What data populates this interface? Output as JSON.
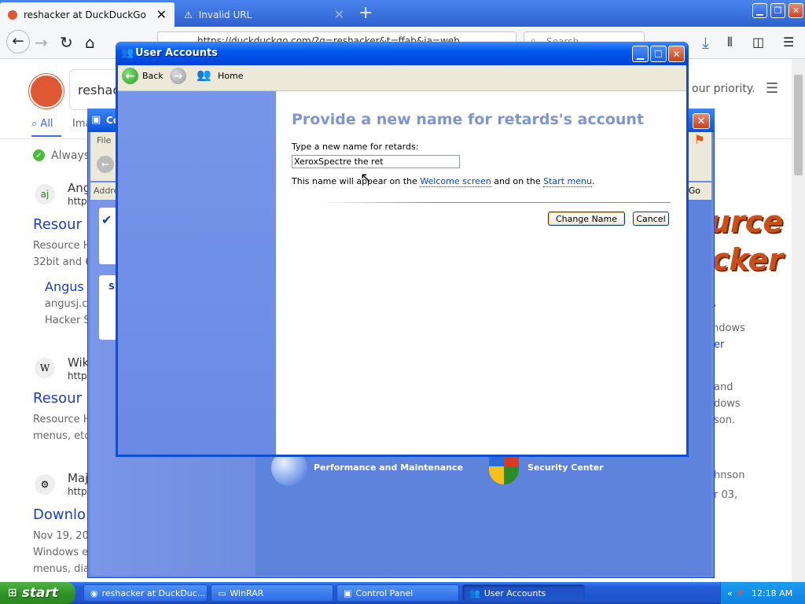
{
  "firefox": {
    "tabs": [
      {
        "title": "reshacker at DuckDuckGo"
      },
      {
        "title": "Invalid URL"
      }
    ],
    "urlbar": {
      "text": "https://duckduckgo.com/?q=reshacker&t=ffab&ia=web"
    },
    "search": {
      "placeholder": "Search"
    }
  },
  "ddg": {
    "search_value": "reshack",
    "privacy_text": "our priority.",
    "tabs": {
      "all": "All",
      "images": "Ima"
    },
    "always_text": "Always",
    "results": [
      {
        "favicon": "aj",
        "site": "Ang",
        "url": "http",
        "title": "Resour",
        "snippet1": "Resource H",
        "snippet2": "32bit and 6"
      },
      {
        "sub_title": "Angus J",
        "sub1": "angusj.co",
        "sub2": "Hacker S"
      },
      {
        "favicon": "W",
        "site": "Wik",
        "url": "http",
        "title": "Resour",
        "snippet1": "Resource H",
        "snippet2": "menus, etc"
      },
      {
        "favicon": "",
        "site": "Maj",
        "url": "http",
        "title": "Downlo",
        "date": "Nov 19, 20",
        "snippet1": "Windows e",
        "snippet2": "menus, dia"
      }
    ],
    "right_panel": {
      "logo_line1": "urce",
      "logo_line2": "cker",
      "heading": "r",
      "lines": [
        "ndows",
        "er",
        "and",
        "dows",
        "son.",
        "hnson",
        "r 03,"
      ]
    }
  },
  "control_panel": {
    "title": "Co",
    "menu_file": "File",
    "address_label": "Addre",
    "go_label": "Go",
    "side_label": "S",
    "categories": [
      {
        "label": "Performance and Maintenance"
      },
      {
        "label": "Security Center"
      }
    ]
  },
  "user_accounts": {
    "title": "User Accounts",
    "toolbar": {
      "back": "Back",
      "home": "Home"
    },
    "heading": "Provide a new name for retards's account",
    "prompt": "Type a new name for retards:",
    "input_value": "XeroxSpectre the ret",
    "note": {
      "pre": "This name will appear on the ",
      "link1": "Welcome screen",
      "mid": " and on the ",
      "link2": "Start menu",
      "post": "."
    },
    "buttons": {
      "change": "Change Name",
      "cancel": "Cancel"
    }
  },
  "taskbar": {
    "start": "start",
    "tasks": [
      {
        "label": "reshacker at DuckDuc..."
      },
      {
        "label": "WinRAR"
      },
      {
        "label": "Control Panel"
      },
      {
        "label": "User Accounts"
      }
    ],
    "clock": "12:18 AM"
  },
  "colors": {
    "xp_blue": "#0b4fd6",
    "heading_blue": "#7d96d0",
    "link_blue": "#0a47a8",
    "ddg_orange": "#de5833",
    "start_green": "#2d8f23"
  }
}
